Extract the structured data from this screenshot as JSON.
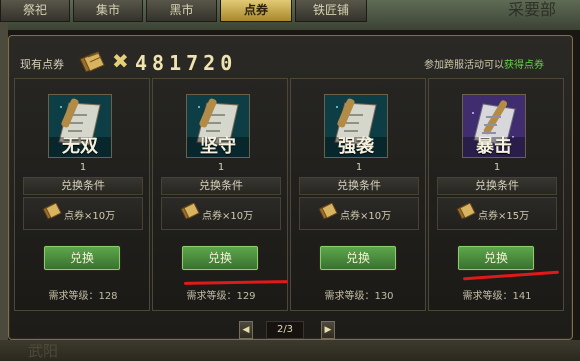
{
  "background": {
    "top_right_text": "采要部",
    "bottom_left_text": "武阳"
  },
  "tabs": [
    {
      "label": "祭祀",
      "active": false
    },
    {
      "label": "集市",
      "active": false
    },
    {
      "label": "黑市",
      "active": false
    },
    {
      "label": "点券",
      "active": true
    },
    {
      "label": "铁匠铺",
      "active": false
    }
  ],
  "header": {
    "points_label": "现有点券",
    "multiply_sign": "✖",
    "points_value": "481720",
    "event_hint": "参加跨服活动可以",
    "event_link": "获得点券"
  },
  "cards": [
    {
      "name": "无双",
      "quantity": "1",
      "condition_title": "兑换条件",
      "cost": "点券×10万",
      "button": "兑换",
      "level_req": "需求等级：128",
      "frame_color": "#113a41"
    },
    {
      "name": "坚守",
      "quantity": "1",
      "condition_title": "兑换条件",
      "cost": "点券×10万",
      "button": "兑换",
      "level_req": "需求等级：129",
      "frame_color": "#113a41"
    },
    {
      "name": "强袭",
      "quantity": "1",
      "condition_title": "兑换条件",
      "cost": "点券×10万",
      "button": "兑换",
      "level_req": "需求等级：130",
      "frame_color": "#113a41"
    },
    {
      "name": "暴击",
      "quantity": "1",
      "condition_title": "兑换条件",
      "cost": "点券×15万",
      "button": "兑换",
      "level_req": "需求等级：141",
      "frame_color": "#392b65"
    }
  ],
  "pager": {
    "page": "2/3",
    "prev": "◀",
    "next": "▶"
  },
  "colors": {
    "accent_gold": "#e1ca75",
    "button_green": "#5da64c",
    "link_green": "#64d447",
    "mark_red": "#e11919"
  }
}
